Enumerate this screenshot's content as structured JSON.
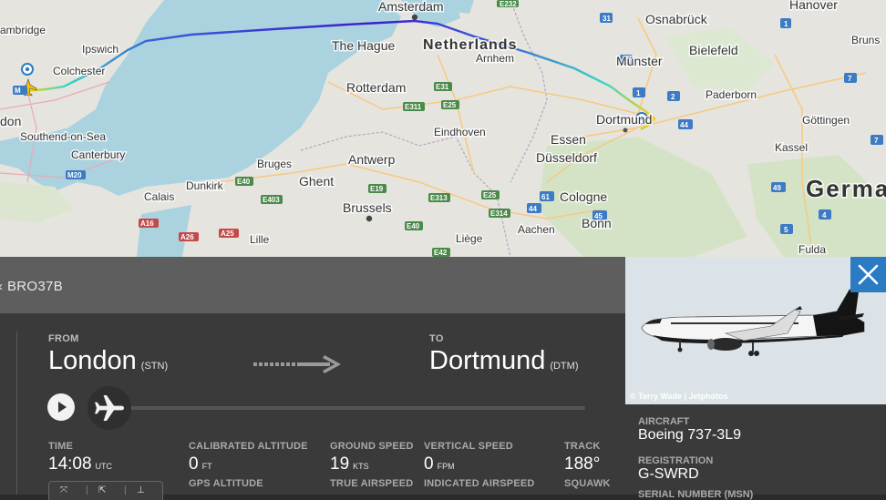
{
  "map": {
    "labels": {
      "amsterdam": "Amsterdam",
      "netherlands": "Netherlands",
      "the_hague": "The Hague",
      "rotterdam": "Rotterdam",
      "arnhem": "Arnhem",
      "eindhoven": "Eindhoven",
      "antwerp": "Antwerp",
      "ghent": "Ghent",
      "bruges": "Bruges",
      "brussels": "Brussels",
      "dunkirk": "Dunkirk",
      "calais": "Calais",
      "lille": "Lille",
      "liege": "Liège",
      "aachen": "Aachen",
      "bonn": "Bonn",
      "cologne": "Cologne",
      "dusseldorf": "Düsseldorf",
      "essen": "Essen",
      "dortmund": "Dortmund",
      "munster": "Münster",
      "osnabruck": "Osnabrück",
      "bielefeld": "Bielefeld",
      "paderborn": "Paderborn",
      "hanover": "Hanover",
      "brunswick": "Bruns",
      "gottingen": "Göttingen",
      "kassel": "Kassel",
      "fulda": "Fulda",
      "germany": "Germa",
      "ipswich": "Ipswich",
      "colchester": "Colchester",
      "cambridge": "ambridge",
      "london": "don",
      "southend": "Southend-on-Sea",
      "canterbury": "Canterbury"
    },
    "roads": [
      "E232",
      "31",
      "1",
      "30",
      "E31",
      "E311",
      "E25",
      "E19",
      "E40",
      "E403",
      "E40",
      "E313",
      "E25",
      "E314",
      "E40",
      "E42",
      "A16",
      "A26",
      "A25",
      "M20",
      "M1",
      "1",
      "2",
      "2",
      "44",
      "61",
      "44",
      "45",
      "49",
      "4",
      "7",
      "1",
      "7",
      "5"
    ]
  },
  "flight": {
    "callsign": "BRO37B",
    "from_caption": "FROM",
    "from_city": "London",
    "from_code": "(STN)",
    "to_caption": "TO",
    "to_city": "Dortmund",
    "to_code": "(DTM)"
  },
  "stats": {
    "time_label": "TIME",
    "time_value": "14:08",
    "time_unit": "UTC",
    "cal_alt_label": "CALIBRATED ALTITUDE",
    "cal_alt_value": "0",
    "cal_alt_unit": "FT",
    "gps_alt_label": "GPS ALTITUDE",
    "ground_speed_label": "GROUND SPEED",
    "ground_speed_value": "19",
    "ground_speed_unit": "KTS",
    "true_airspeed_label": "TRUE AIRSPEED",
    "vertical_speed_label": "VERTICAL SPEED",
    "vertical_speed_value": "0",
    "vertical_speed_unit": "FPM",
    "indicated_airspeed_label": "INDICATED AIRSPEED",
    "track_label": "TRACK",
    "track_value": "188°",
    "squawk_label": "SQUAWK"
  },
  "aircraft": {
    "photo_credit": "© Terry Wade | Jetphotos",
    "aircraft_label": "AIRCRAFT",
    "aircraft_value": "Boeing 737-3L9",
    "registration_label": "REGISTRATION",
    "registration_value": "G-SWRD",
    "serial_label": "SERIAL NUMBER (MSN)"
  },
  "icons": {
    "close": "close-icon",
    "play": "play-icon",
    "plane": "airplane-icon",
    "arrow": "route-arrow-icon"
  },
  "colors": {
    "accent": "#2b7bc3",
    "panel_dark": "#3a3a3a",
    "panel_mid": "#5e5e5e"
  }
}
